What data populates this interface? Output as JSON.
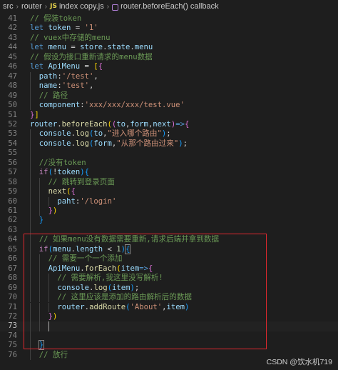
{
  "breadcrumb": {
    "items": [
      "src",
      "router",
      "index copy.js",
      "router.beforeEach() callback"
    ],
    "file_icon_label": "JS",
    "separator": "›"
  },
  "editor": {
    "active_line": 73,
    "lines": [
      {
        "n": "41",
        "tokens": [
          [
            "cm",
            "// 假装token"
          ]
        ],
        "indent": 0
      },
      {
        "n": "42",
        "tokens": [
          [
            "kw",
            "let "
          ],
          [
            "var",
            "token"
          ],
          [
            "pn",
            " = "
          ],
          [
            "str",
            "'1'"
          ]
        ],
        "indent": 0
      },
      {
        "n": "43",
        "tokens": [
          [
            "cm",
            "// vuex中存储的menu"
          ]
        ],
        "indent": 0
      },
      {
        "n": "44",
        "tokens": [
          [
            "kw",
            "let "
          ],
          [
            "var",
            "menu"
          ],
          [
            "pn",
            " = "
          ],
          [
            "var",
            "store"
          ],
          [
            "pn",
            "."
          ],
          [
            "var",
            "state"
          ],
          [
            "pn",
            "."
          ],
          [
            "var",
            "menu"
          ]
        ],
        "indent": 0
      },
      {
        "n": "45",
        "tokens": [
          [
            "cm",
            "// 假设为接口重新请求的menu数据"
          ]
        ],
        "indent": 0
      },
      {
        "n": "46",
        "tokens": [
          [
            "kw",
            "let "
          ],
          [
            "var",
            "ApiMenu"
          ],
          [
            "pn",
            " = "
          ],
          [
            "br1",
            "["
          ],
          [
            "br2",
            "{"
          ]
        ],
        "indent": 0
      },
      {
        "n": "47",
        "tokens": [
          [
            "var",
            "path"
          ],
          [
            "pn",
            ":"
          ],
          [
            "str",
            "'/test'"
          ],
          [
            "pn",
            ","
          ]
        ],
        "indent": 1
      },
      {
        "n": "48",
        "tokens": [
          [
            "var",
            "name"
          ],
          [
            "pn",
            ":"
          ],
          [
            "str",
            "'test'"
          ],
          [
            "pn",
            ","
          ]
        ],
        "indent": 1
      },
      {
        "n": "49",
        "tokens": [
          [
            "cm",
            "// 路径"
          ]
        ],
        "indent": 1
      },
      {
        "n": "50",
        "tokens": [
          [
            "var",
            "component"
          ],
          [
            "pn",
            ":"
          ],
          [
            "str",
            "'xxx/xxx/xxx/test.vue'"
          ]
        ],
        "indent": 1
      },
      {
        "n": "51",
        "tokens": [
          [
            "br2",
            "}"
          ],
          [
            "br1",
            "]"
          ]
        ],
        "indent": 0
      },
      {
        "n": "52",
        "tokens": [
          [
            "var",
            "router"
          ],
          [
            "pn",
            "."
          ],
          [
            "fn",
            "beforeEach"
          ],
          [
            "br1",
            "("
          ],
          [
            "br2",
            "("
          ],
          [
            "var",
            "to"
          ],
          [
            "pn",
            ","
          ],
          [
            "var",
            "form"
          ],
          [
            "pn",
            ","
          ],
          [
            "var",
            "next"
          ],
          [
            "br2",
            ")"
          ],
          [
            "kw",
            "=>"
          ],
          [
            "br2",
            "{"
          ]
        ],
        "indent": 0
      },
      {
        "n": "53",
        "tokens": [
          [
            "var",
            "console"
          ],
          [
            "pn",
            "."
          ],
          [
            "fn",
            "log"
          ],
          [
            "br3",
            "("
          ],
          [
            "var",
            "to"
          ],
          [
            "pn",
            ","
          ],
          [
            "str",
            "\"进入哪个路由\""
          ],
          [
            "br3",
            ")"
          ],
          [
            "pn",
            ";"
          ]
        ],
        "indent": 1
      },
      {
        "n": "54",
        "tokens": [
          [
            "var",
            "console"
          ],
          [
            "pn",
            "."
          ],
          [
            "fn",
            "log"
          ],
          [
            "br3",
            "("
          ],
          [
            "var",
            "form"
          ],
          [
            "pn",
            ","
          ],
          [
            "str",
            "\"从那个路由过来\""
          ],
          [
            "br3",
            ")"
          ],
          [
            "pn",
            ";"
          ]
        ],
        "indent": 1
      },
      {
        "n": "55",
        "tokens": [],
        "indent": 1
      },
      {
        "n": "56",
        "tokens": [
          [
            "cm",
            "//没有token"
          ]
        ],
        "indent": 1
      },
      {
        "n": "57",
        "tokens": [
          [
            "ctl",
            "if"
          ],
          [
            "br3",
            "("
          ],
          [
            "pn",
            "!"
          ],
          [
            "var",
            "token"
          ],
          [
            "br3",
            ")"
          ],
          [
            "br3",
            "{"
          ]
        ],
        "indent": 1
      },
      {
        "n": "58",
        "tokens": [
          [
            "cm",
            "// 跳转到登录页面"
          ]
        ],
        "indent": 2
      },
      {
        "n": "59",
        "tokens": [
          [
            "fn",
            "next"
          ],
          [
            "br1",
            "("
          ],
          [
            "br2",
            "{"
          ]
        ],
        "indent": 2
      },
      {
        "n": "60",
        "tokens": [
          [
            "var",
            "paht"
          ],
          [
            "pn",
            ":"
          ],
          [
            "str",
            "'/login'"
          ]
        ],
        "indent": 3
      },
      {
        "n": "61",
        "tokens": [
          [
            "br2",
            "}"
          ],
          [
            "br1",
            ")"
          ]
        ],
        "indent": 2
      },
      {
        "n": "62",
        "tokens": [
          [
            "br3",
            "}"
          ]
        ],
        "indent": 1
      },
      {
        "n": "63",
        "tokens": [],
        "indent": 1
      },
      {
        "n": "64",
        "tokens": [
          [
            "cm",
            "// 如果menu没有数据需要重新,请求后端并拿到数据"
          ]
        ],
        "indent": 1
      },
      {
        "n": "65",
        "tokens": [
          [
            "ctl",
            "if"
          ],
          [
            "br3",
            "("
          ],
          [
            "var",
            "menu"
          ],
          [
            "pn",
            "."
          ],
          [
            "var",
            "length"
          ],
          [
            "pn",
            " < "
          ],
          [
            "num",
            "1"
          ],
          [
            "br3",
            ")"
          ],
          [
            "br3",
            "{"
          ]
        ],
        "indent": 1,
        "match_brace": true
      },
      {
        "n": "66",
        "tokens": [
          [
            "cm",
            "// 需要一个一个添加"
          ]
        ],
        "indent": 2
      },
      {
        "n": "67",
        "tokens": [
          [
            "var",
            "ApiMenu"
          ],
          [
            "pn",
            "."
          ],
          [
            "fn",
            "forEach"
          ],
          [
            "br1",
            "("
          ],
          [
            "var",
            "item"
          ],
          [
            "kw",
            "=>"
          ],
          [
            "br2",
            "{"
          ]
        ],
        "indent": 2
      },
      {
        "n": "68",
        "tokens": [
          [
            "cm",
            "// 需要解析,我这里没写解析!"
          ]
        ],
        "indent": 3
      },
      {
        "n": "69",
        "tokens": [
          [
            "var",
            "console"
          ],
          [
            "pn",
            "."
          ],
          [
            "fn",
            "log"
          ],
          [
            "br3",
            "("
          ],
          [
            "var",
            "item"
          ],
          [
            "br3",
            ")"
          ],
          [
            "pn",
            ";"
          ]
        ],
        "indent": 3
      },
      {
        "n": "70",
        "tokens": [
          [
            "cm",
            "// 这里应该是添加的路由解析后的数据"
          ]
        ],
        "indent": 3
      },
      {
        "n": "71",
        "tokens": [
          [
            "var",
            "router"
          ],
          [
            "pn",
            "."
          ],
          [
            "fn",
            "addRoute"
          ],
          [
            "br3",
            "("
          ],
          [
            "str",
            "'About'"
          ],
          [
            "pn",
            ","
          ],
          [
            "var",
            "item"
          ],
          [
            "br3",
            ")"
          ]
        ],
        "indent": 3
      },
      {
        "n": "72",
        "tokens": [
          [
            "br2",
            "}"
          ],
          [
            "br1",
            ")"
          ]
        ],
        "indent": 2
      },
      {
        "n": "73",
        "tokens": [],
        "indent": 2
      },
      {
        "n": "74",
        "tokens": [],
        "indent": 1
      },
      {
        "n": "75",
        "tokens": [
          [
            "br3",
            "}"
          ]
        ],
        "indent": 1,
        "match_brace": true
      },
      {
        "n": "76",
        "tokens": [
          [
            "cm",
            "// 放行"
          ]
        ],
        "indent": 1
      }
    ]
  },
  "watermark": "CSDN @饮水机719",
  "colors": {
    "background": "#1e1e1e",
    "highlight_box": "#e0282e",
    "comment": "#6a9955",
    "keyword": "#569cd6",
    "string": "#ce9178",
    "variable": "#9cdcfe",
    "function": "#dcdcaa"
  }
}
